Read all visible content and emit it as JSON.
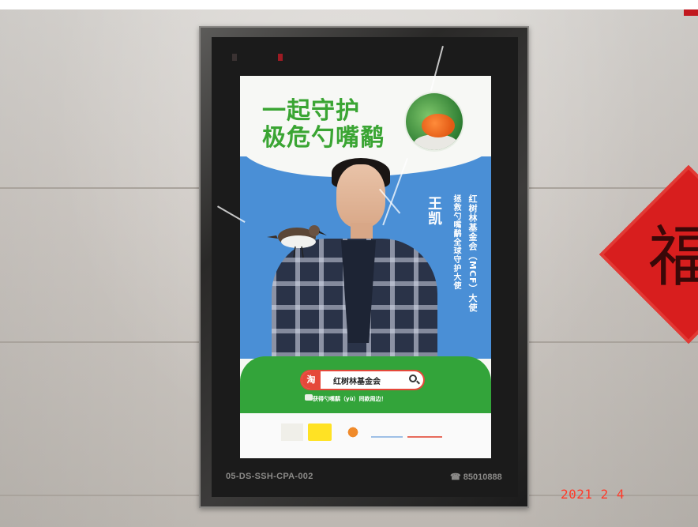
{
  "poster": {
    "headline_line1": "一起守护",
    "headline_line2": "极危勺嘴鹬",
    "ambassador_name": "王凯",
    "ambassador_title_line1": "红树林基金会（MCF）大使",
    "ambassador_title_line2": "拯救勺嘴鹬全球守护大使",
    "search_logo": "淘",
    "search_query": "红树林基金会",
    "tagline": "获得勺嘴鹬（yù）同款周边！"
  },
  "frame": {
    "code": "05-DS-SSH-CPA-002",
    "phone": "☎ 85010888"
  },
  "wall": {
    "decoration_char": "福"
  },
  "photo": {
    "date_stamp": "2021  2  4"
  },
  "colors": {
    "green": "#3aa533",
    "blue": "#4a8fd6",
    "red": "#d81e1e",
    "date": "#ff3b2b"
  }
}
